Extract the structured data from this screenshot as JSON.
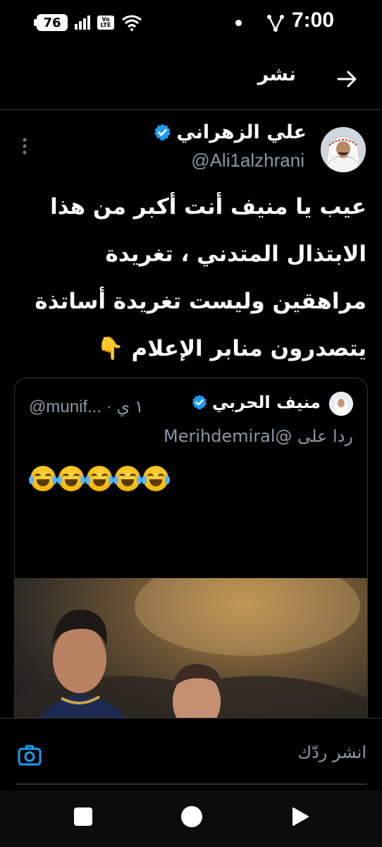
{
  "status_bar": {
    "battery": "76",
    "volte": "Vo LTE",
    "time": "7:00"
  },
  "header": {
    "title": "نشر"
  },
  "tweet": {
    "author_name": "علي الزهراني",
    "handle": "@Ali1alzhrani",
    "text": "عيب يا منيف أنت أكبر من هذا الابتذال المتدني ، تغريدة مراهقين وليست تغريدة أساتذة يتصدرون منابر الإعلام 👇"
  },
  "quote": {
    "author_name": "منيف الحربي",
    "handle_time": "@munif... · ١ ي",
    "reply_prefix": "ردا على",
    "reply_mention": "@Merihdemiral",
    "emojis": "😂😂😂😂😂"
  },
  "reply": {
    "placeholder": "انشر ردّك"
  },
  "colors": {
    "background": "#000000",
    "verified_blue": "#1d9bf0",
    "secondary_text": "#8b98a5",
    "border": "#2f3336"
  }
}
